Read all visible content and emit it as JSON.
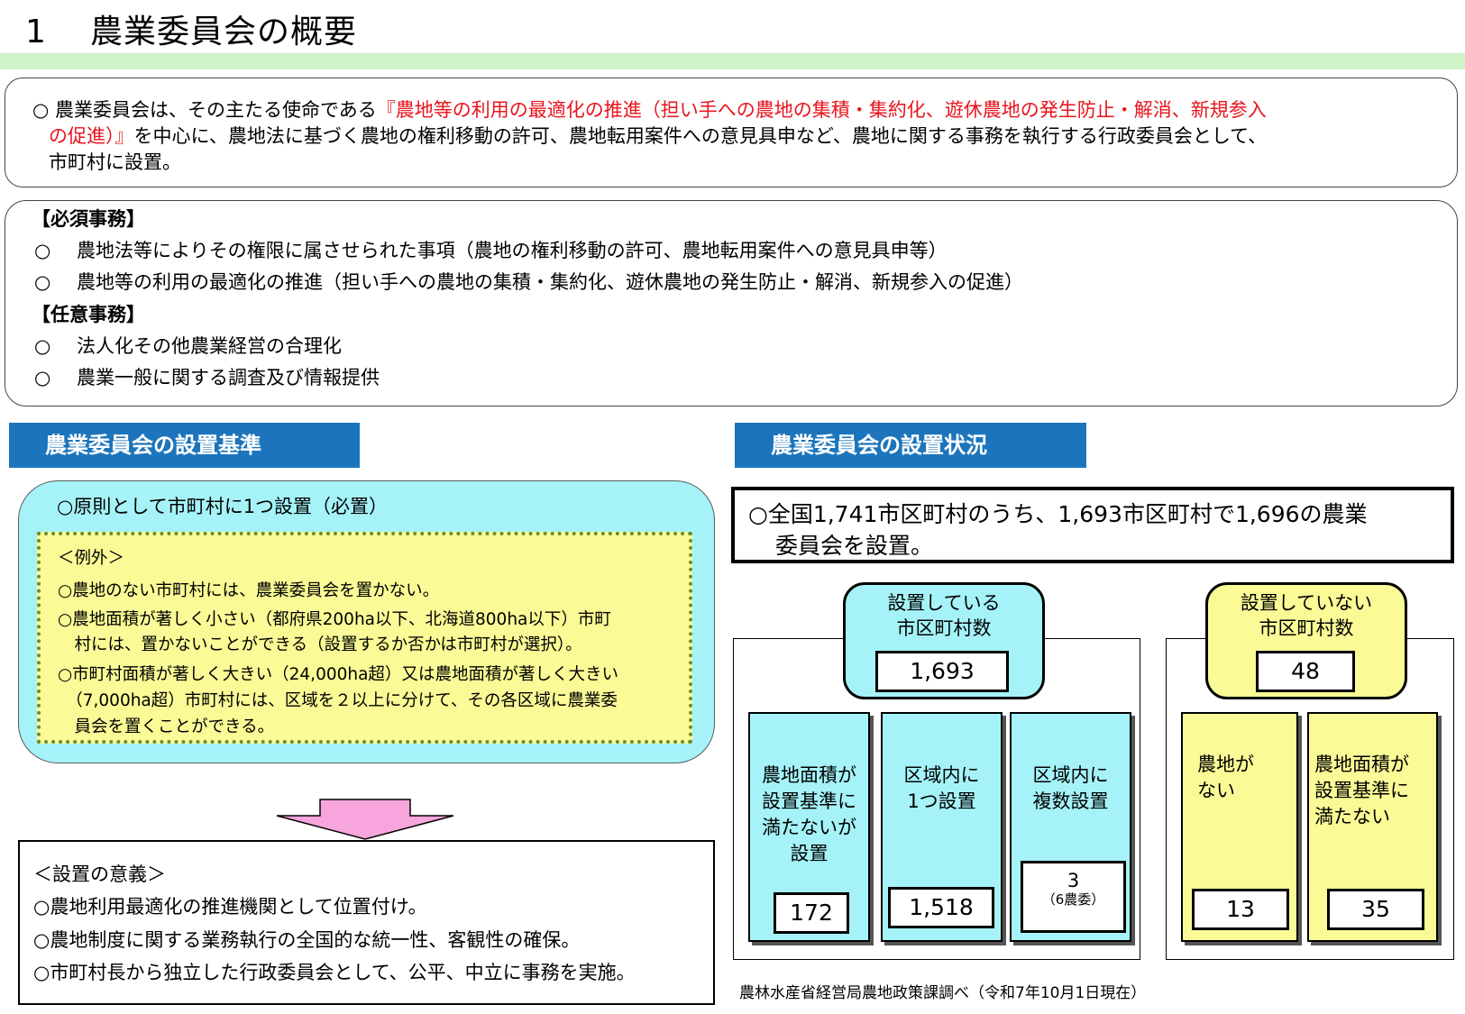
{
  "title": {
    "number": "1",
    "text": "農業委員会の概要"
  },
  "intro": {
    "lead": "○ 農業委員会は、その主たる使命である",
    "red_1": "『農地等の利用の最適化の推進（担い手への農地の集積・集約化、遊休農地の発生防止・解消、新規参入",
    "red_2": "の促進）』",
    "rest_2": "を中心に、農地法に基づく農地の権利移動の許可、農地転用案件への意見具申など、農地に関する事務を執行する行政委員会として、",
    "line_3": "市町村に設置。"
  },
  "duties": {
    "mandatory_heading": "【必須事務】",
    "mandatory": [
      "農地法等によりその権限に属させられた事項（農地の権利移動の許可、農地転用案件への意見具申等）",
      "農地等の利用の最適化の推進（担い手への農地の集積・集約化、遊休農地の発生防止・解消、新規参入の促進）"
    ],
    "optional_heading": "【任意事務】",
    "optional": [
      "法人化その他農業経営の合理化",
      "農業一般に関する調査及び情報提供"
    ],
    "bullet": "○"
  },
  "criteria": {
    "heading": "農業委員会の設置基準",
    "principle": "○原則として市町村に1つ設置（必置）",
    "exceptions": [
      "＜例外＞",
      "○農地のない市町村には、農業委員会を置かない。",
      "○農地面積が著しく小さい（都府県200ha以下、北海道800ha以下）市町",
      "　村には、置かないことができる（設置するか否かは市町村が選択）。",
      "○市町村面積が著しく大きい（24,000ha超）又は農地面積が著しく大きい",
      "　（7,000ha超）市町村には、区域を２以上に分けて、その各区域に農業委",
      "　員会を置くことができる。"
    ]
  },
  "significance": [
    "＜設置の意義＞",
    "○農地利用最適化の推進機関として位置付け。",
    "○農地制度に関する業務執行の全国的な統一性、客観性の確保。",
    "○市町村長から独立した行政委員会として、公平、中立に事務を実施。"
  ],
  "status": {
    "heading": "農業委員会の設置状況",
    "summary_1": "○全国1,741市区町村のうち、1,693市区町村で1,696の農業",
    "summary_2": "委員会を設置。",
    "established": {
      "label_1": "設置している",
      "label_2": "市区町村数",
      "count": "1,693",
      "breakdown": [
        {
          "lines": [
            "農地面積が",
            "設置基準に",
            "満たないが",
            "設置"
          ],
          "count": "172",
          "note": ""
        },
        {
          "lines": [
            "区域内に",
            "1つ設置"
          ],
          "count": "1,518",
          "note": ""
        },
        {
          "lines": [
            "区域内に",
            "複数設置"
          ],
          "count": "3",
          "note": "（6農委）"
        }
      ]
    },
    "not_established": {
      "label_1": "設置していない",
      "label_2": "市区町村数",
      "count": "48",
      "breakdown": [
        {
          "lines": [
            "農地が",
            "ない"
          ],
          "count": "13"
        },
        {
          "lines": [
            "農地面積が",
            "設置基準に",
            "満たない"
          ],
          "count": "35"
        }
      ]
    }
  },
  "footnote": "農林水産省経営局農地政策課調べ（令和7年10月1日現在）",
  "colors": {
    "header_blue": "#1c75bc",
    "cyan": "#a5f3f8",
    "yellow": "#fafa96",
    "red_text": "#e8141c",
    "green_bar": "#cff2c6",
    "arrow_pink": "#f7a5dc"
  }
}
